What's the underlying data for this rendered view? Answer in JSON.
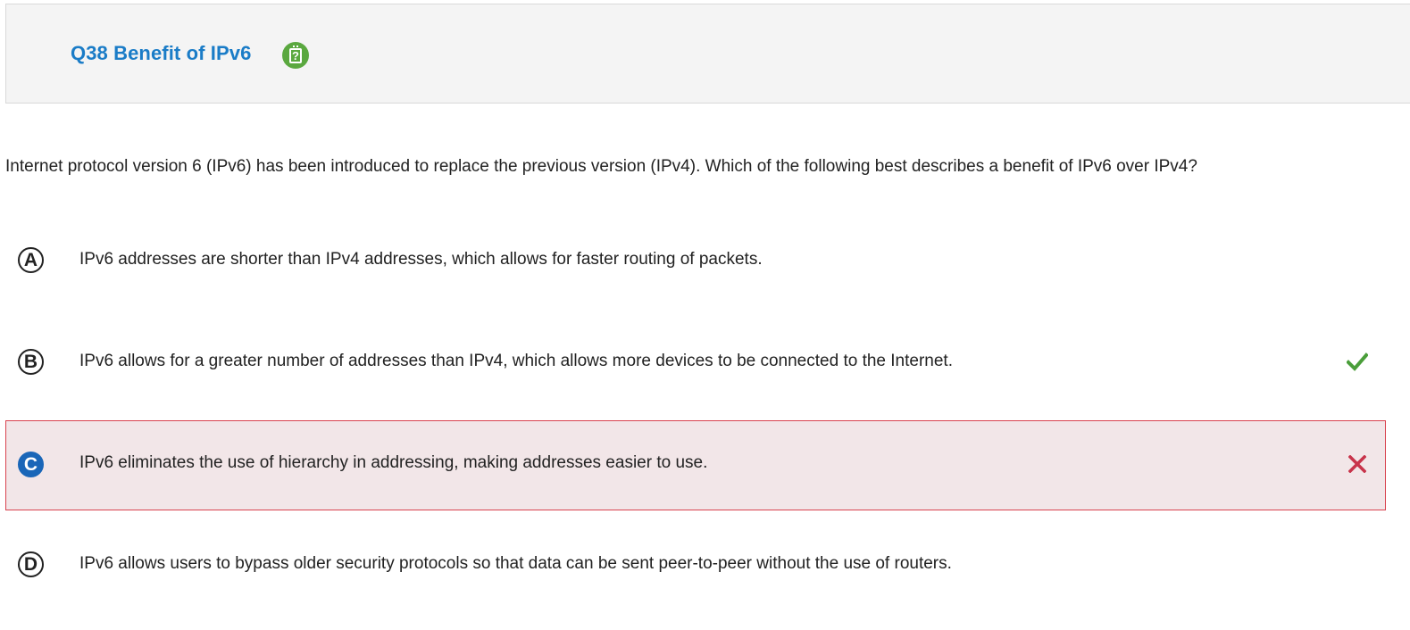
{
  "header": {
    "title": "Q38 Benefit of IPv6",
    "help_icon": "help-notepad-icon"
  },
  "question": {
    "text": "Internet protocol version 6 (IPv6) has been introduced to replace the previous version (IPv4). Which of the following best describes a benefit of IPv6 over IPv4?"
  },
  "options": [
    {
      "letter": "A",
      "text": "IPv6 addresses are shorter than IPv4 addresses, which allows for faster routing of packets.",
      "status": "none"
    },
    {
      "letter": "B",
      "text": "IPv6 allows for a greater number of addresses than IPv4, which allows more devices to be connected to the Internet.",
      "status": "correct"
    },
    {
      "letter": "C",
      "text": "IPv6 eliminates the use of hierarchy in addressing, making addresses easier to use.",
      "status": "incorrect-selected"
    },
    {
      "letter": "D",
      "text": "IPv6 allows users to bypass older security protocols so that data can be sent peer-to-peer without the use of routers.",
      "status": "none"
    }
  ],
  "colors": {
    "title": "#1a7cc7",
    "help_icon": "#5aa83f",
    "correct_mark": "#4a9e3a",
    "incorrect_mark": "#c8334a",
    "selected_bg": "#f2e6e8",
    "selected_border": "#d9434f",
    "selected_letter": "#1a66b8"
  }
}
